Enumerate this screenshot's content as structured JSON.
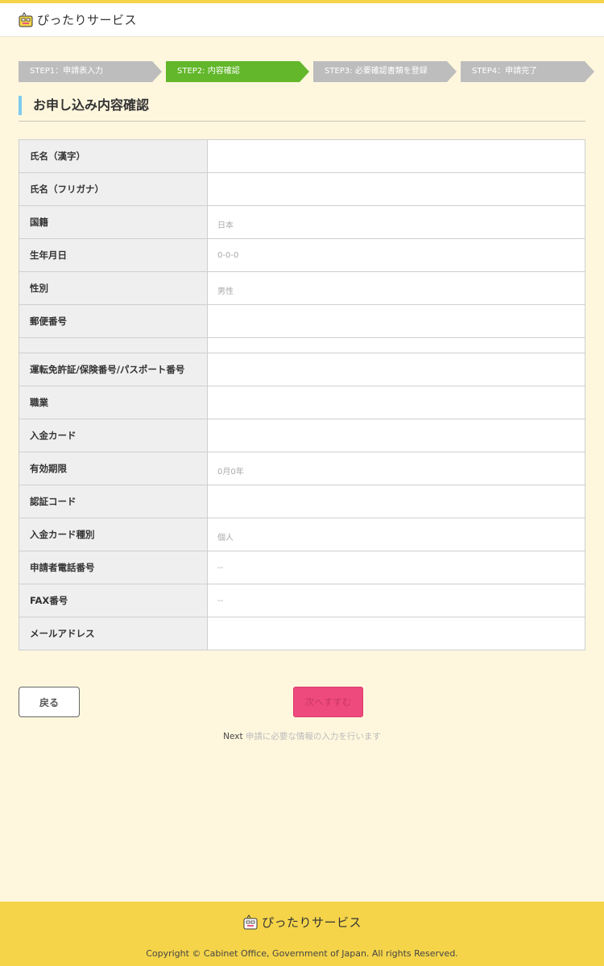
{
  "header": {
    "logo_text": "ぴったりサービス",
    "logo_icon": "pittari-logo-icon"
  },
  "steps": [
    {
      "label": "STEP1：申請表入力",
      "state": "done"
    },
    {
      "label": "STEP2: 内容確認",
      "state": "active"
    },
    {
      "label": "STEP3: 必要確認書類を登録",
      "state": "todo"
    },
    {
      "label": "STEP4：申請完了",
      "state": "todo"
    }
  ],
  "section": {
    "title": "お申し込み内容確認"
  },
  "rows": [
    {
      "label": "氏名（漢字）",
      "value": ""
    },
    {
      "label": "氏名（フリガナ）",
      "value": ""
    },
    {
      "label": "国籍",
      "value": "日本"
    },
    {
      "label": "生年月日",
      "value": "0-0-0"
    },
    {
      "label": "性別",
      "value": "男性"
    },
    {
      "label": "郵便番号",
      "value": ""
    },
    {
      "label": "",
      "value": ""
    },
    {
      "label": "運転免許証/保険番号/パスポート番号",
      "value": ""
    },
    {
      "label": "職業",
      "value": ""
    },
    {
      "label": "入金カード",
      "value": ""
    },
    {
      "label": "有効期限",
      "value": "0月0年"
    },
    {
      "label": "認証コード",
      "value": ""
    },
    {
      "label": "入金カード種別",
      "value": "個人"
    },
    {
      "label": "申請者電話番号",
      "value": "--"
    },
    {
      "label": "FAX番号",
      "value": "--"
    },
    {
      "label": "メールアドレス",
      "value": ""
    }
  ],
  "buttons": {
    "back_label": "戻る",
    "next_label": "次へすすむ"
  },
  "hint": {
    "prefix": "Next",
    "text": " 申請に必要な情報の入力を行います"
  },
  "footer": {
    "logo_text": "ぴったりサービス",
    "copyright": "Copyright © Cabinet Office, Government of Japan. All rights Reserved."
  },
  "colors": {
    "header_accent": "#f5d44a",
    "step_done": "#bdbdbd",
    "step_active": "#62b72a",
    "step_todo": "#bdbdbd",
    "title_bar": "#7dcbed",
    "next_button": "#ef4a7d",
    "page_bg": "#fef7de"
  }
}
